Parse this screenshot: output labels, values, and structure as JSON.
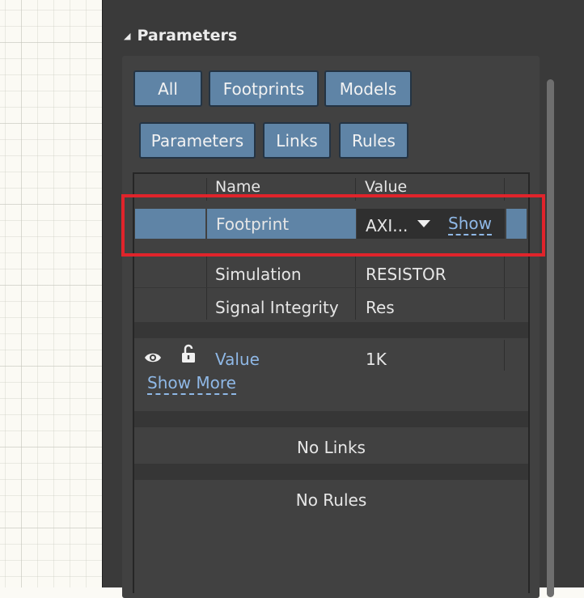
{
  "section": {
    "title": "Parameters"
  },
  "filters": {
    "row1": [
      "All",
      "Footprints",
      "Models"
    ],
    "row2": [
      "Parameters",
      "Links",
      "Rules"
    ]
  },
  "table": {
    "headers": {
      "name": "Name",
      "value": "Value"
    },
    "selected": {
      "name": "Footprint",
      "value": "AXI...",
      "action": "Show"
    },
    "rows": [
      {
        "name": "Simulation",
        "value": "RESISTOR"
      },
      {
        "name": "Signal Integrity",
        "value": "Res"
      }
    ],
    "param": {
      "name": "Value",
      "value": "1K"
    },
    "show_more": "Show More",
    "no_links": "No Links",
    "no_rules": "No Rules"
  },
  "colors": {
    "accent": "#5f84a6",
    "highlight": "#e0242b",
    "panel": "#3a3a3a",
    "link": "#8fb8e6"
  },
  "icons": {
    "visibility": "eye-icon",
    "lock": "unlock-icon",
    "dropdown": "dropdown-arrow-icon",
    "collapse": "collapse-triangle-icon"
  }
}
